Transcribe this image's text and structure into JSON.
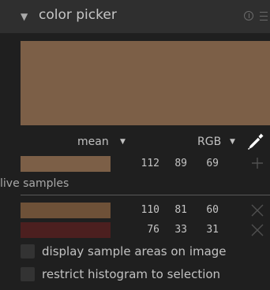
{
  "header": {
    "title": "color picker",
    "collapse_icon": "triangle-down-icon",
    "info_icon": "info-icon",
    "menu_icon": "hamburger-menu-icon"
  },
  "main_swatch": {
    "color": "#7c5f47"
  },
  "controls": {
    "statistic": "mean",
    "color_space": "RGB",
    "picker_icon": "eyedropper-icon"
  },
  "current_sample": {
    "color": "#7c5f47",
    "values": [
      "112",
      "89",
      "69"
    ],
    "action_icon": "plus-icon"
  },
  "live_samples": {
    "label": "live samples",
    "items": [
      {
        "color": "#6e5138",
        "values": [
          "110",
          "81",
          "60"
        ],
        "action_icon": "close-icon"
      },
      {
        "color": "#4c1f1f",
        "values": [
          "76",
          "33",
          "31"
        ],
        "action_icon": "close-icon"
      }
    ]
  },
  "options": [
    {
      "label": "display sample areas on image",
      "checked": false
    },
    {
      "label": "restrict histogram to selection",
      "checked": false
    }
  ],
  "colors": {
    "panel_bg": "#1f1f1f",
    "header_bg": "#2f2f2f",
    "text": "#c2c2c2",
    "divider": "#5a5a5a"
  }
}
